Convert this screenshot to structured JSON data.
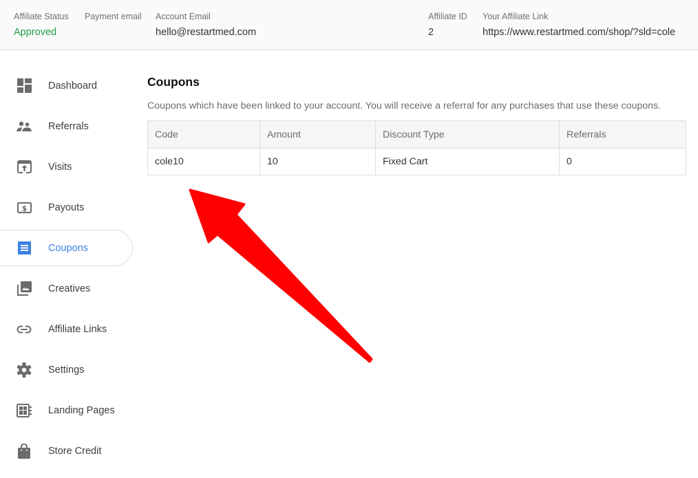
{
  "header": {
    "affiliate_status": {
      "label": "Affiliate Status",
      "value": "Approved",
      "color": "#1e9e44"
    },
    "payment_email": {
      "label": "Payment email",
      "value": ""
    },
    "account_email": {
      "label": "Account Email",
      "value": "hello@restartmed.com"
    },
    "affiliate_id": {
      "label": "Affiliate ID",
      "value": "2"
    },
    "affiliate_link": {
      "label": "Your Affiliate Link",
      "value": "https://www.restartmed.com/shop/?sld=cole"
    }
  },
  "sidebar": {
    "active_color": "#3b82e3",
    "items": [
      {
        "label": "Dashboard",
        "icon": "dashboard-icon"
      },
      {
        "label": "Referrals",
        "icon": "people-icon"
      },
      {
        "label": "Visits",
        "icon": "open-in-browser-icon"
      },
      {
        "label": "Payouts",
        "icon": "dollar-bill-icon"
      },
      {
        "label": "Coupons",
        "icon": "coupon-receipt-icon",
        "active": true
      },
      {
        "label": "Creatives",
        "icon": "photo-library-icon"
      },
      {
        "label": "Affiliate Links",
        "icon": "link-icon"
      },
      {
        "label": "Settings",
        "icon": "gear-icon"
      },
      {
        "label": "Landing Pages",
        "icon": "landing-page-icon"
      },
      {
        "label": "Store Credit",
        "icon": "shopping-bag-icon"
      }
    ]
  },
  "main": {
    "title": "Coupons",
    "description": "Coupons which have been linked to your account. You will receive a referral for any purchases that use these coupons.",
    "table": {
      "columns": [
        "Code",
        "Amount",
        "Discount Type",
        "Referrals"
      ],
      "rows": [
        [
          "cole10",
          "10",
          "Fixed Cart",
          "0"
        ]
      ]
    }
  },
  "annotation": {
    "type": "arrow",
    "color": "#ff0000",
    "points_to": "coupon code cole10"
  }
}
